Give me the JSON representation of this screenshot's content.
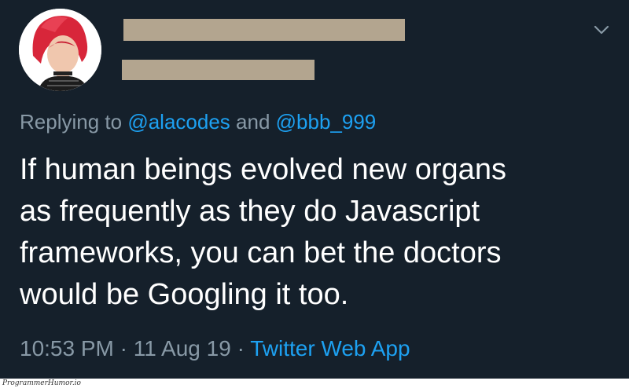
{
  "tweet": {
    "avatar_alt": "profile picture",
    "replying_prefix": "Replying to ",
    "reply_to_1": "@alacodes",
    "reply_joiner": " and ",
    "reply_to_2": "@bbb_999",
    "lines": [
      "If human beings evolved new organs",
      "as frequently as they do Javascript",
      "frameworks, you can bet the doctors",
      "would be Googling it too."
    ],
    "time": "10:53 PM",
    "separator": " · ",
    "date": "11 Aug 19",
    "source": "Twitter Web App"
  },
  "icons": {
    "caret": "chevron-down-icon"
  },
  "watermark": "ProgrammerHumor.io",
  "colors": {
    "background": "#15202b",
    "text": "#ffffff",
    "muted": "#8899a6",
    "accent": "#1da1f2",
    "redaction": "#b3a58f"
  }
}
